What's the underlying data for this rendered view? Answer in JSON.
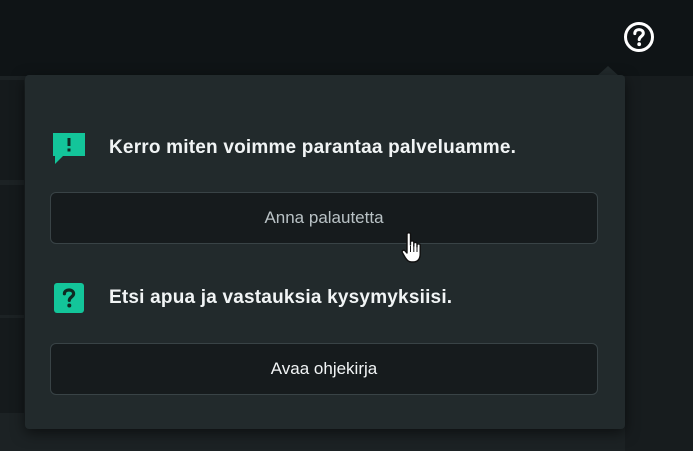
{
  "colors": {
    "accent": "#13c59a",
    "popover_bg": "#222a2c",
    "topbar_bg": "#0f1416",
    "button_bg": "#161b1d",
    "button_border": "#394346"
  },
  "header": {
    "help_icon": "question-circle-icon"
  },
  "popover": {
    "feedback": {
      "icon": "feedback-speech-bubble-icon",
      "text": "Kerro miten voimme parantaa palveluamme.",
      "button_label": "Anna palautetta"
    },
    "help": {
      "icon": "question-square-icon",
      "text": "Etsi apua ja vastauksia kysymyksiisi.",
      "button_label": "Avaa ohjekirja"
    }
  },
  "cursor": {
    "icon": "hand-pointer-cursor-icon"
  }
}
